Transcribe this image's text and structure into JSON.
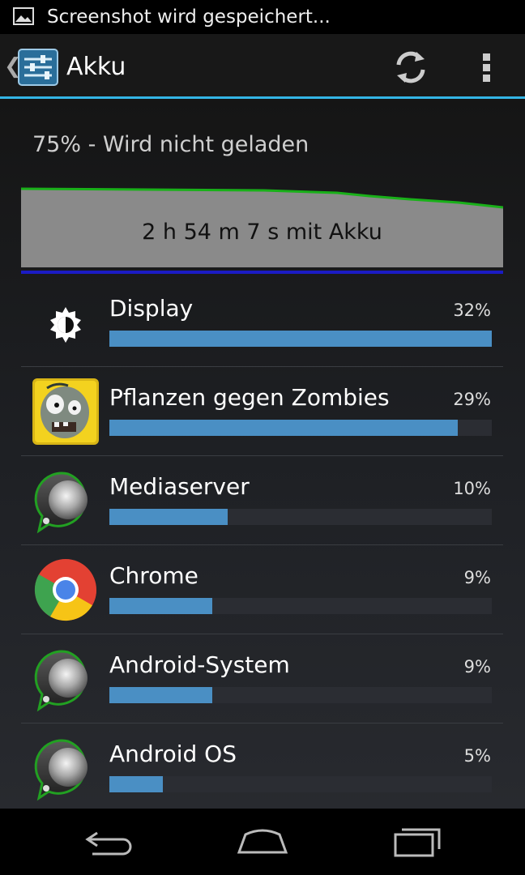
{
  "status_bar": {
    "notification_text": "Screenshot wird gespeichert..."
  },
  "action_bar": {
    "title": "Akku",
    "icon": "settings-icon"
  },
  "battery": {
    "status": "75% - Wird nicht geladen",
    "time_on_battery": "2 h 54 m 7 s mit Akku"
  },
  "usage": [
    {
      "label": "Display",
      "percent_text": "32%",
      "fill": 1.0,
      "icon": "brightness-icon"
    },
    {
      "label": "Pflanzen gegen Zombies",
      "percent_text": "29%",
      "fill": 0.91,
      "icon": "zombie-app-icon"
    },
    {
      "label": "Mediaserver",
      "percent_text": "10%",
      "fill": 0.31,
      "icon": "android-system-icon"
    },
    {
      "label": "Chrome",
      "percent_text": "9%",
      "fill": 0.27,
      "icon": "chrome-icon"
    },
    {
      "label": "Android-System",
      "percent_text": "9%",
      "fill": 0.27,
      "icon": "android-system-icon"
    },
    {
      "label": "Android OS",
      "percent_text": "5%",
      "fill": 0.14,
      "icon": "android-system-icon"
    }
  ],
  "colors": {
    "accent": "#33b5e5",
    "bar": "#4a8fc4",
    "graph_line": "#19b019",
    "graph_fill": "#8a8a8a"
  }
}
